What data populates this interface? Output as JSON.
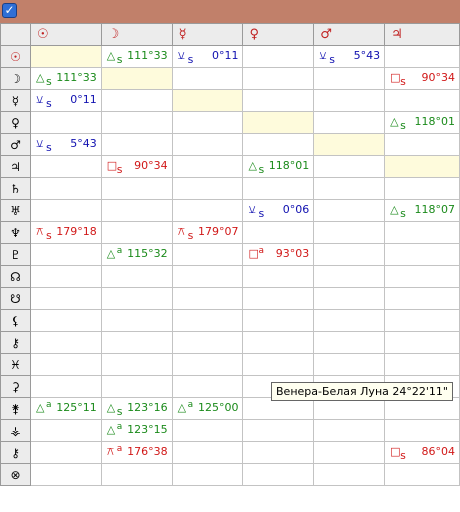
{
  "window": {
    "app_icon": "checkmark-app-icon"
  },
  "columns": [
    "☉",
    "☽",
    "☿",
    "♀",
    "♂",
    "♃"
  ],
  "rows": [
    "☉",
    "☽",
    "☿",
    "♀",
    "♂",
    "♃",
    "♄",
    "♅",
    "♆",
    "♇",
    "☊",
    "☋",
    "⚸",
    "⚷",
    "♓",
    "⚳",
    "⚵",
    "⚶",
    "⚷",
    "⊗"
  ],
  "highlighted_row": 0,
  "aspect_colors": {
    "trine": "#1a8a1a",
    "square": "#d11818",
    "semisextile": "#1010b0",
    "quincunx": "#d11818"
  },
  "grid": [
    [
      null,
      {
        "sym": "△",
        "mark": "s",
        "val": "111°33",
        "type": "trine"
      },
      {
        "sym": "⚺",
        "mark": "s",
        "val": "0°11",
        "type": "semisext"
      },
      null,
      {
        "sym": "⚺",
        "mark": "s",
        "val": "5°43",
        "type": "semisext"
      },
      null
    ],
    [
      {
        "sym": "△",
        "mark": "s",
        "val": "111°33",
        "type": "trine"
      },
      null,
      null,
      null,
      null,
      {
        "sym": "□",
        "mark": "s",
        "val": "90°34",
        "type": "square"
      }
    ],
    [
      {
        "sym": "⚺",
        "mark": "s",
        "val": "0°11",
        "type": "semisext"
      },
      null,
      null,
      null,
      null,
      null
    ],
    [
      null,
      null,
      null,
      null,
      null,
      {
        "sym": "△",
        "mark": "s",
        "val": "118°01",
        "type": "trine"
      }
    ],
    [
      {
        "sym": "⚺",
        "mark": "s",
        "val": "5°43",
        "type": "semisext"
      },
      null,
      null,
      null,
      null,
      null
    ],
    [
      null,
      {
        "sym": "□",
        "mark": "s",
        "val": "90°34",
        "type": "square"
      },
      null,
      {
        "sym": "△",
        "mark": "s",
        "val": "118°01",
        "type": "trine"
      },
      null,
      null
    ],
    [
      null,
      null,
      null,
      null,
      null,
      null
    ],
    [
      null,
      null,
      null,
      {
        "sym": "⚺",
        "mark": "s",
        "val": "0°06",
        "type": "semisext"
      },
      null,
      {
        "sym": "△",
        "mark": "s",
        "val": "118°07",
        "type": "trine"
      }
    ],
    [
      {
        "sym": "⚻",
        "mark": "s",
        "val": "179°18",
        "type": "quincunx"
      },
      null,
      {
        "sym": "⚻",
        "mark": "s",
        "val": "179°07",
        "type": "quincunx"
      },
      null,
      null,
      null
    ],
    [
      null,
      {
        "sym": "△",
        "mark": "a",
        "val": "115°32",
        "type": "trine"
      },
      null,
      {
        "sym": "□",
        "mark": "a",
        "val": "93°03",
        "type": "square"
      },
      null,
      null
    ],
    [
      null,
      null,
      null,
      null,
      null,
      null
    ],
    [
      null,
      null,
      null,
      null,
      null,
      null
    ],
    [
      null,
      null,
      null,
      null,
      null,
      null
    ],
    [
      null,
      null,
      null,
      null,
      null,
      null
    ],
    [
      null,
      null,
      null,
      null,
      null,
      null
    ],
    [
      null,
      null,
      null,
      null,
      null,
      null
    ],
    [
      {
        "sym": "△",
        "mark": "a",
        "val": "125°11",
        "type": "trine"
      },
      {
        "sym": "△",
        "mark": "s",
        "val": "123°16",
        "type": "trine"
      },
      {
        "sym": "△",
        "mark": "a",
        "val": "125°00",
        "type": "trine"
      },
      null,
      null,
      null
    ],
    [
      null,
      {
        "sym": "△",
        "mark": "a",
        "val": "123°15",
        "type": "trine"
      },
      null,
      null,
      null,
      null
    ],
    [
      null,
      {
        "sym": "⚻",
        "mark": "a",
        "val": "176°38",
        "type": "quincunx"
      },
      null,
      null,
      null,
      {
        "sym": "□",
        "mark": "s",
        "val": "86°04",
        "type": "square"
      }
    ],
    [
      null,
      null,
      null,
      null,
      null,
      null
    ]
  ],
  "tooltip": {
    "text": "Венера-Белая Луна  24°22'11\""
  }
}
